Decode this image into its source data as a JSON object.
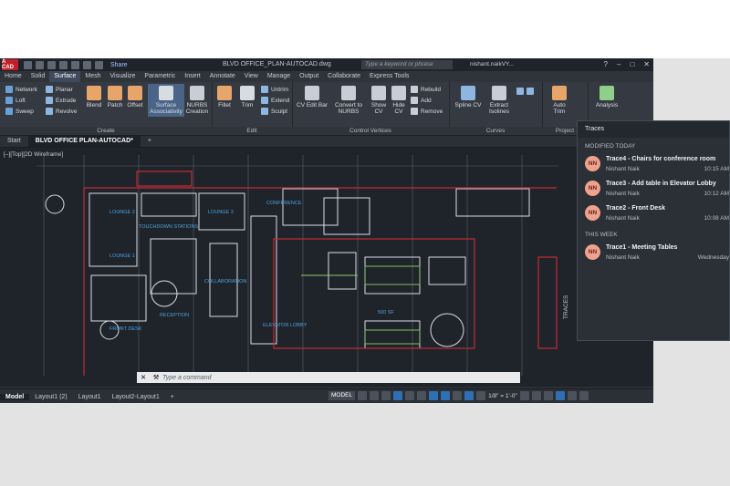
{
  "app": {
    "logo": "A CAD",
    "doc_title": "BLVD OFFICE_PLAN-AUTOCAD.dwg",
    "share": "Share",
    "search_placeholder": "Type a keyword or phrase",
    "user": "nishant.naikVY...",
    "help": "?"
  },
  "menu": [
    "Home",
    "Solid",
    "Surface",
    "Mesh",
    "Visualize",
    "Parametric",
    "Insert",
    "Annotate",
    "View",
    "Manage",
    "Output",
    "Collaborate",
    "Express Tools"
  ],
  "menu_active": "Surface",
  "ribbon": {
    "create": {
      "title": "Create",
      "items": [
        "Network",
        "Loft",
        "Sweep",
        "Planar",
        "Extrude",
        "Revolve",
        "Blend",
        "Patch",
        "Offset",
        "Surface Associativity",
        "NURBS Creation"
      ]
    },
    "edit": {
      "title": "Edit",
      "items": [
        "Fillet",
        "Trim",
        "Untrim",
        "Extend",
        "Sculpt"
      ]
    },
    "control_vertices": {
      "title": "Control Vertices",
      "items": [
        "CV Edit Bar",
        "Convert to NURBS",
        "Show CV",
        "Hide CV",
        "Rebuild",
        "Add",
        "Remove"
      ]
    },
    "curves": {
      "title": "Curves",
      "items": [
        "Spline CV",
        "Extract Isolines"
      ]
    },
    "project": {
      "title": "Project",
      "items": [
        "Auto Trim"
      ]
    },
    "analysis": {
      "items": [
        "Analysis"
      ]
    }
  },
  "tabs": [
    "Start",
    "BLVD OFFICE PLAN-AUTOCAD*"
  ],
  "drawing": {
    "view_label": "[–][Top][2D Wireframe]",
    "room_labels": [
      "LOUNGE 2",
      "LOUNGE 3",
      "TOUCHDOWN STATIONS",
      "LOUNGE 1",
      "COLLABORATION",
      "RECEPTION",
      "FRONT DESK",
      "ELEVATOR LOBBY",
      "CONFERENCE",
      "500 SF"
    ]
  },
  "command": {
    "placeholder": "Type a command"
  },
  "status": {
    "layout_tabs": [
      "Model",
      "Layout1 (2)",
      "Layout1",
      "Layout2-Layout1"
    ],
    "model_button": "MODEL",
    "scale": "1/8\" = 1'-0\""
  },
  "traces": {
    "title": "Traces",
    "side_label": "TRACES",
    "modified_today": "MODIFIED TODAY",
    "this_week": "THIS WEEK",
    "items": [
      {
        "initials": "NN",
        "name": "Trace4 - Chairs for conference room",
        "user": "Nishant Naik",
        "time": "10:15 AM"
      },
      {
        "initials": "NN",
        "name": "Trace3 - Add table in Elevator Lobby",
        "user": "Nishant Naik",
        "time": "10:12 AM"
      },
      {
        "initials": "NN",
        "name": "Trace2 - Front Desk",
        "user": "Nishant Naik",
        "time": "10:08 AM"
      },
      {
        "initials": "NN",
        "name": "Trace1 - Meeting Tables",
        "user": "Nishant Naik",
        "time": "Wednesday"
      }
    ]
  },
  "colors": {
    "accent": "#2f6fb5",
    "brand_red": "#c21f2a",
    "avatar": "#f0a28c"
  }
}
